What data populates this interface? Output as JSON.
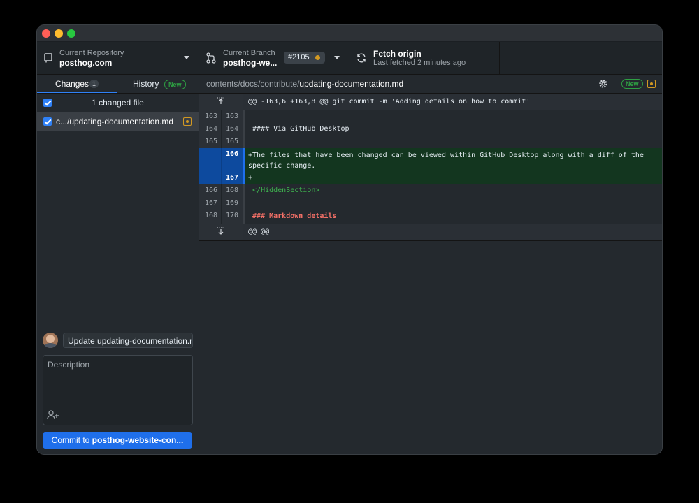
{
  "toolbar": {
    "repository": {
      "label": "Current Repository",
      "value": "posthog.com",
      "icon": "repo-icon"
    },
    "branch": {
      "label": "Current Branch",
      "value": "posthog-we...",
      "pr": "#2105",
      "icon": "branch-icon"
    },
    "fetch": {
      "label": "Fetch origin",
      "sublabel": "Last fetched 2 minutes ago",
      "icon": "sync-icon"
    }
  },
  "sidebar": {
    "tabs": [
      {
        "label": "Changes",
        "count": "1"
      },
      {
        "label": "History",
        "badge": "New"
      }
    ],
    "header": "1 changed file",
    "files": [
      {
        "name": "c.../updating-documentation.md",
        "status": "modified"
      }
    ]
  },
  "commit": {
    "summary": "Update updating-documentation.md",
    "description_placeholder": "Description",
    "button_prefix": "Commit to ",
    "button_branch": "posthog-website-con..."
  },
  "path": {
    "dir": "contents/docs/contribute/",
    "file": "updating-documentation.md",
    "settings_badge": "New"
  },
  "diff": {
    "hunk_header": "@@ -163,6 +163,8 @@ git commit -m 'Adding details on how to commit'",
    "lines": [
      {
        "old": "163",
        "new": "163",
        "text": "",
        "type": "context"
      },
      {
        "old": "164",
        "new": "164",
        "text": " #### Via GitHub Desktop",
        "type": "context"
      },
      {
        "old": "165",
        "new": "165",
        "text": "",
        "type": "context"
      },
      {
        "old": "",
        "new": "166",
        "text": "+The files that have been changed can be viewed within GitHub Desktop along with a diff of the specific change.",
        "type": "added"
      },
      {
        "old": "",
        "new": "167",
        "text": "+",
        "type": "added"
      },
      {
        "old": "166",
        "new": "168",
        "text": " </HiddenSection>",
        "type": "context"
      },
      {
        "old": "167",
        "new": "169",
        "text": "",
        "type": "context"
      },
      {
        "old": "168",
        "new": "170",
        "text": " ### Markdown details",
        "type": "context"
      }
    ],
    "footer": "@@ @@"
  },
  "colors": {
    "accent": "#1f6feb",
    "added_bg": "#13361f",
    "tag_green": "#3fb950",
    "heading_red": "#f47067",
    "modified": "#d29922"
  }
}
